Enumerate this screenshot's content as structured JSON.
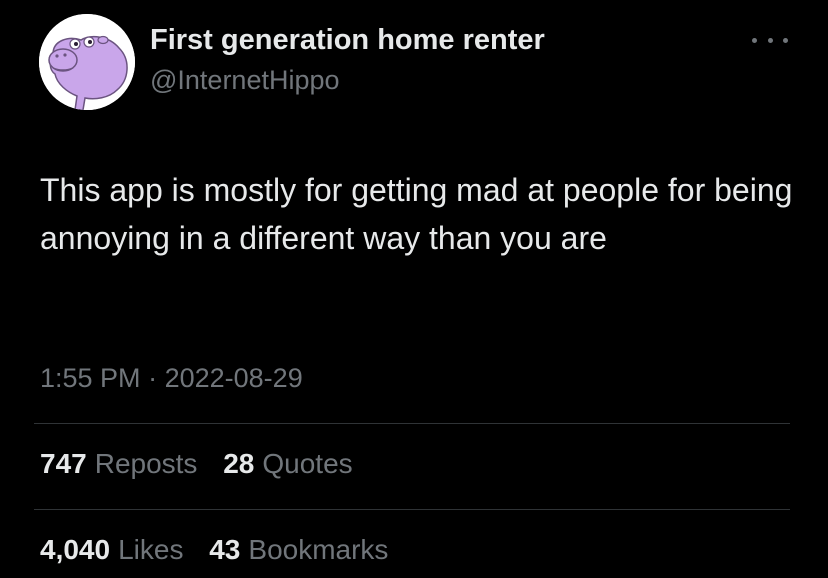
{
  "tweet": {
    "display_name": "First generation home renter",
    "handle": "@InternetHippo",
    "avatar_icon": "hippo-avatar-icon",
    "more_icon": "more-options-icon",
    "text": "This app is mostly for getting mad at people for being annoying in a different way than you are",
    "time": "1:55 PM",
    "separator": "·",
    "date": "2022-08-29"
  },
  "stats": {
    "reposts": {
      "count": "747",
      "label": "Reposts"
    },
    "quotes": {
      "count": "28",
      "label": "Quotes"
    },
    "likes": {
      "count": "4,040",
      "label": "Likes"
    },
    "bookmarks": {
      "count": "43",
      "label": "Bookmarks"
    }
  },
  "colors": {
    "background": "#000000",
    "primary_text": "#e7e9ea",
    "secondary_text": "#71767b",
    "divider": "#2f3336",
    "avatar_hippo": "#c9a6ea"
  }
}
